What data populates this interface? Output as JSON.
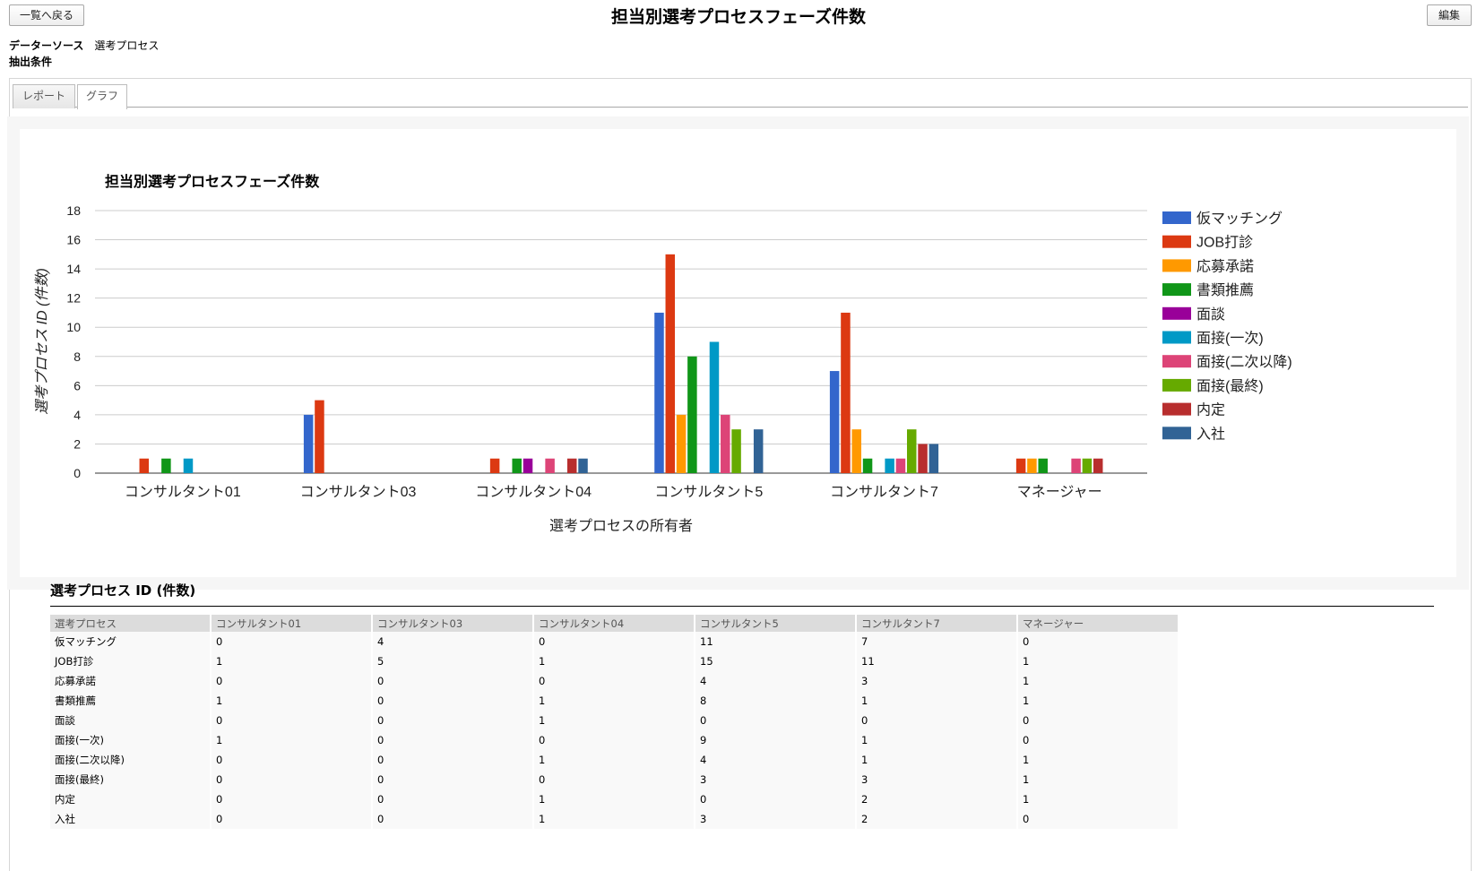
{
  "header": {
    "back_label": "一覧へ戻る",
    "title": "担当別選考プロセスフェーズ件数",
    "edit_label": "編集",
    "datasource_label": "データーソース",
    "datasource_value": "選考プロセス",
    "filter_label": "抽出条件"
  },
  "tabs": [
    {
      "label": "レポート",
      "active": false
    },
    {
      "label": "グラフ",
      "active": true
    }
  ],
  "chart_data": {
    "type": "bar",
    "title": "担当別選考プロセスフェーズ件数",
    "xlabel": "選考プロセスの所有者",
    "ylabel": "選考プロセス ID (件数)",
    "ylim": [
      0,
      18
    ],
    "yticks": [
      0,
      2,
      4,
      6,
      8,
      10,
      12,
      14,
      16,
      18
    ],
    "legend_position": "right",
    "categories": [
      "コンサルタント01",
      "コンサルタント03",
      "コンサルタント04",
      "コンサルタント5",
      "コンサルタント7",
      "マネージャー"
    ],
    "series": [
      {
        "name": "仮マッチング",
        "color": "#3366cc",
        "values": [
          0,
          4,
          0,
          11,
          7,
          0
        ]
      },
      {
        "name": "JOB打診",
        "color": "#dc3912",
        "values": [
          1,
          5,
          1,
          15,
          11,
          1
        ]
      },
      {
        "name": "応募承諾",
        "color": "#ff9900",
        "values": [
          0,
          0,
          0,
          4,
          3,
          1
        ]
      },
      {
        "name": "書類推薦",
        "color": "#109618",
        "values": [
          1,
          0,
          1,
          8,
          1,
          1
        ]
      },
      {
        "name": "面談",
        "color": "#990099",
        "values": [
          0,
          0,
          1,
          0,
          0,
          0
        ]
      },
      {
        "name": "面接(一次)",
        "color": "#0099c6",
        "values": [
          1,
          0,
          0,
          9,
          1,
          0
        ]
      },
      {
        "name": "面接(二次以降)",
        "color": "#dd4477",
        "values": [
          0,
          0,
          1,
          4,
          1,
          1
        ]
      },
      {
        "name": "面接(最終)",
        "color": "#66aa00",
        "values": [
          0,
          0,
          0,
          3,
          3,
          1
        ]
      },
      {
        "name": "内定",
        "color": "#b82e2e",
        "values": [
          0,
          0,
          1,
          0,
          2,
          1
        ]
      },
      {
        "name": "入社",
        "color": "#316395",
        "values": [
          0,
          0,
          1,
          3,
          2,
          0
        ]
      }
    ]
  },
  "table": {
    "heading": "選考プロセス ID (件数)",
    "headers": [
      "選考プロセス",
      "コンサルタント01",
      "コンサルタント03",
      "コンサルタント04",
      "コンサルタント5",
      "コンサルタント7",
      "マネージャー"
    ],
    "rows": [
      [
        "仮マッチング",
        "0",
        "4",
        "0",
        "11",
        "7",
        "0"
      ],
      [
        "JOB打診",
        "1",
        "5",
        "1",
        "15",
        "11",
        "1"
      ],
      [
        "応募承諾",
        "0",
        "0",
        "0",
        "4",
        "3",
        "1"
      ],
      [
        "書類推薦",
        "1",
        "0",
        "1",
        "8",
        "1",
        "1"
      ],
      [
        "面談",
        "0",
        "0",
        "1",
        "0",
        "0",
        "0"
      ],
      [
        "面接(一次)",
        "1",
        "0",
        "0",
        "9",
        "1",
        "0"
      ],
      [
        "面接(二次以降)",
        "0",
        "0",
        "1",
        "4",
        "1",
        "1"
      ],
      [
        "面接(最終)",
        "0",
        "0",
        "0",
        "3",
        "3",
        "1"
      ],
      [
        "内定",
        "0",
        "0",
        "1",
        "0",
        "2",
        "1"
      ],
      [
        "入社",
        "0",
        "0",
        "1",
        "3",
        "2",
        "0"
      ]
    ]
  }
}
